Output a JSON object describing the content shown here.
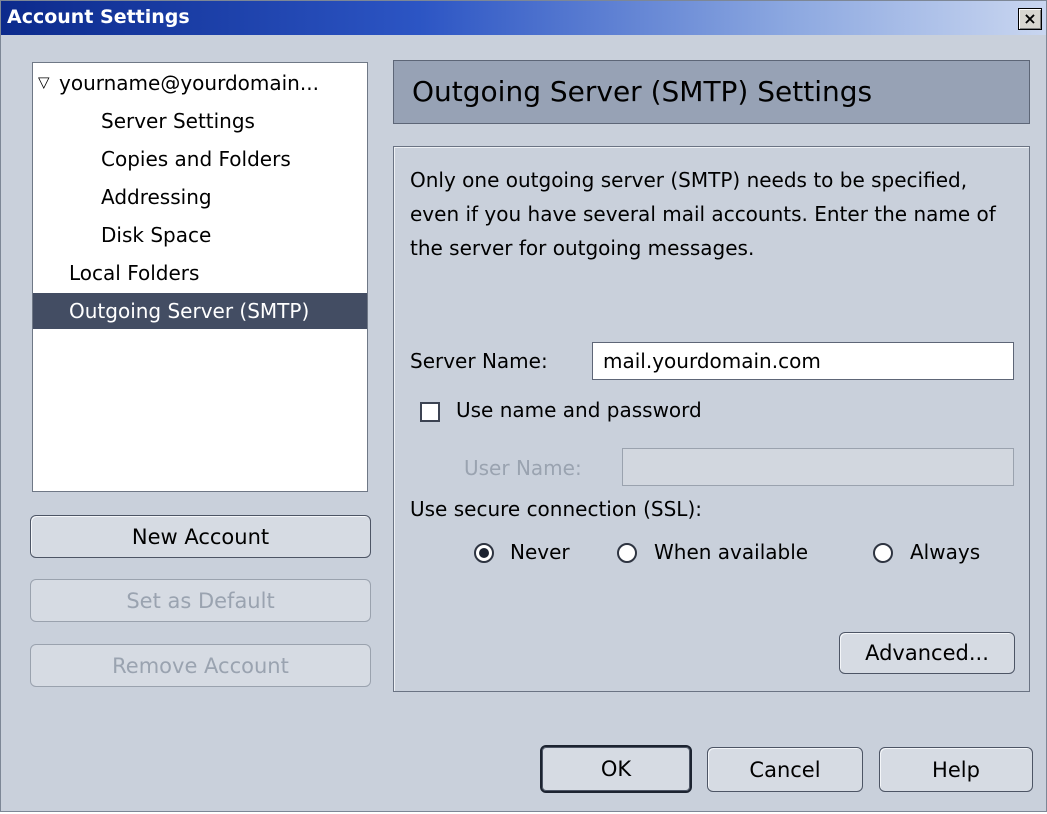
{
  "window": {
    "title": "Account Settings",
    "close_label": "×"
  },
  "sidebar": {
    "tree": [
      {
        "label": "yourname@yourdomain...",
        "level": 0,
        "expanded": true,
        "twisty": "▽"
      },
      {
        "label": "Server Settings",
        "level": 1
      },
      {
        "label": "Copies and Folders",
        "level": 1
      },
      {
        "label": "Addressing",
        "level": 1
      },
      {
        "label": "Disk Space",
        "level": 1
      },
      {
        "label": "Local Folders",
        "level": 0
      },
      {
        "label": "Outgoing Server (SMTP)",
        "level": 0,
        "selected": true
      }
    ],
    "buttons": {
      "new_account": "New Account",
      "set_default": "Set as Default",
      "remove_account": "Remove Account"
    }
  },
  "panel": {
    "header": "Outgoing Server (SMTP) Settings",
    "description": "Only one outgoing server (SMTP) needs to be specified, even if you have several mail accounts. Enter the name of the server for outgoing messages.",
    "server_name_label": "Server Name:",
    "server_name_value": "mail.yourdomain.com",
    "use_auth_label": "Use name and password",
    "use_auth_checked": false,
    "user_name_label": "User Name:",
    "user_name_value": "",
    "ssl_label": "Use secure connection (SSL):",
    "ssl_options": [
      "Never",
      "When available",
      "Always"
    ],
    "ssl_selected": "Never",
    "advanced_button": "Advanced..."
  },
  "footer": {
    "ok": "OK",
    "cancel": "Cancel",
    "help": "Help"
  },
  "colors": {
    "window_bg": "#c9d0db",
    "selection": "#434d63",
    "header_bg": "#97a2b5",
    "title_start": "#0c2a8c"
  }
}
